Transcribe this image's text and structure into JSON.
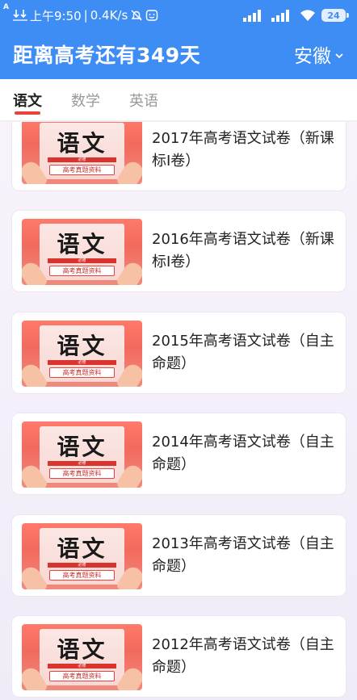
{
  "status_bar": {
    "time": "上午9:50",
    "speed": "0.4K/s",
    "battery": "24"
  },
  "header": {
    "title": "距离高考还有349天",
    "region": "安徽"
  },
  "tabs": [
    {
      "label": "语文",
      "active": true
    },
    {
      "label": "数学",
      "active": false
    },
    {
      "label": "英语",
      "active": false
    }
  ],
  "thumbnail": {
    "subject_char": "语文",
    "band_text": "必修",
    "tag_text": "高考真题资料"
  },
  "papers": [
    {
      "title": "2017年高考语文试卷（新课标I卷）"
    },
    {
      "title": "2016年高考语文试卷（新课标I卷）"
    },
    {
      "title": "2015年高考语文试卷（自主命题）"
    },
    {
      "title": "2014年高考语文试卷（自主命题）"
    },
    {
      "title": "2013年高考语文试卷（自主命题）"
    },
    {
      "title": "2012年高考语文试卷（自主命题）"
    }
  ],
  "colors": {
    "header_blue": "#3d8df5",
    "tab_indicator": "#e9413c"
  }
}
